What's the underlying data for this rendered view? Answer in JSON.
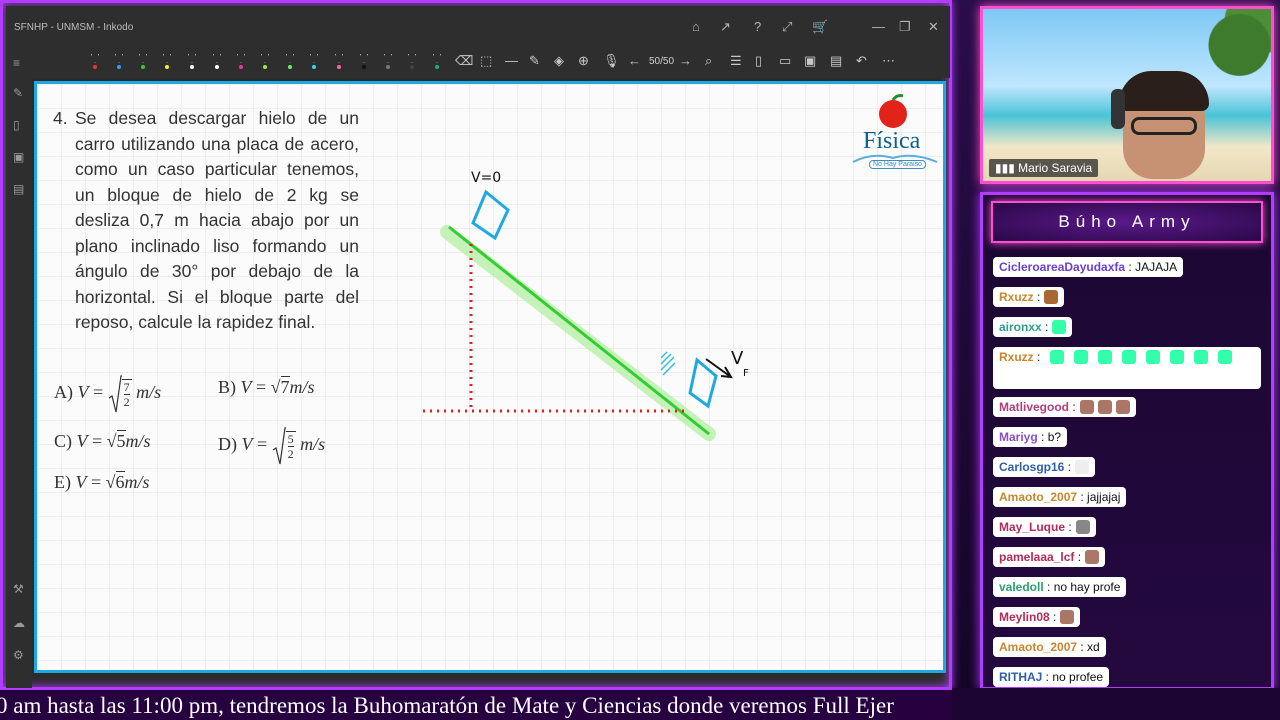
{
  "window": {
    "title": "SFNHP - UNMSM - Inkodo",
    "page_counter": "50/50"
  },
  "problem": {
    "number": "4.",
    "text": "Se desea descargar hielo de un carro utilizando una placa de acero, como un caso particular tenemos, un bloque de hielo de 2 kg se desliza 0,7 m hacia abajo por un plano inclinado liso formando un ángulo de 30° por debajo de la horizontal. Si el bloque parte del reposo, calcule la rapidez final.",
    "options": {
      "a_label": "A)",
      "a_var": "V",
      "a_unit": "m/s",
      "a_num": "7",
      "a_den": "2",
      "b_label": "B)",
      "b_var": "V",
      "b_root": "7",
      "b_unit": "m/s",
      "c_label": "C)",
      "c_var": "V",
      "c_root": "5",
      "c_unit": "m/s",
      "d_label": "D)",
      "d_var": "V",
      "d_num": "5",
      "d_den": "2",
      "d_unit": "m/s",
      "e_label": "E)",
      "e_var": "V",
      "e_root": "6",
      "e_unit": "m/s"
    }
  },
  "drawing": {
    "v0_label": "V=0",
    "vf_label": "V",
    "vf_sub": "F"
  },
  "logo": {
    "title": "Física",
    "subtitle": "No Hay Paraiso"
  },
  "webcam": {
    "name": "Mario Saravia"
  },
  "chat": {
    "title": "Búho Army",
    "messages": [
      {
        "user": "CicleroareaDayudaxfa",
        "text": ": JAJAJA",
        "color": "#6a3fd1"
      },
      {
        "user": "Rxuzz",
        "text": ":",
        "color": "#c9872b"
      },
      {
        "user": "aironxx",
        "text": ":",
        "color": "#2b9e8f"
      },
      {
        "user": "Rxuzz",
        "text": ":",
        "color": "#c9872b"
      },
      {
        "user": "Matlivegood",
        "text": ":",
        "color": "#b0407a"
      },
      {
        "user": "Mariyg",
        "text": ": b?",
        "color": "#8a4fc7"
      },
      {
        "user": "Carlosgp16",
        "text": ":",
        "color": "#2e5fa8"
      },
      {
        "user": "Amaoto_2007",
        "text": ": jajjajaj",
        "color": "#c9872b"
      },
      {
        "user": "May_Luque",
        "text": ":",
        "color": "#b52a5a"
      },
      {
        "user": "pamelaaa_lcf",
        "text": ":",
        "color": "#b52a5a"
      },
      {
        "user": "valedoll",
        "text": ": no hay profe",
        "color": "#2b9e6f"
      },
      {
        "user": "Meylin08",
        "text": ":",
        "color": "#b52a5a"
      },
      {
        "user": "Amaoto_2007",
        "text": ": xd",
        "color": "#c9872b"
      },
      {
        "user": "RITHAJ",
        "text": ": no profee",
        "color": "#2e5fa8"
      }
    ]
  },
  "ticker": {
    "text": "0 am hasta las 11:00 pm, tendremos la Buhomaratón de Mate y Ciencias donde veremos Full Ejer"
  },
  "colors": {
    "frame_purple": "#b23cff",
    "frame_pink": "#ff4fd0",
    "canvas_border": "#1fa9e1",
    "incline_green": "#33cc33",
    "block_blue": "#1fa9e1",
    "dotted_red": "#e02020"
  }
}
